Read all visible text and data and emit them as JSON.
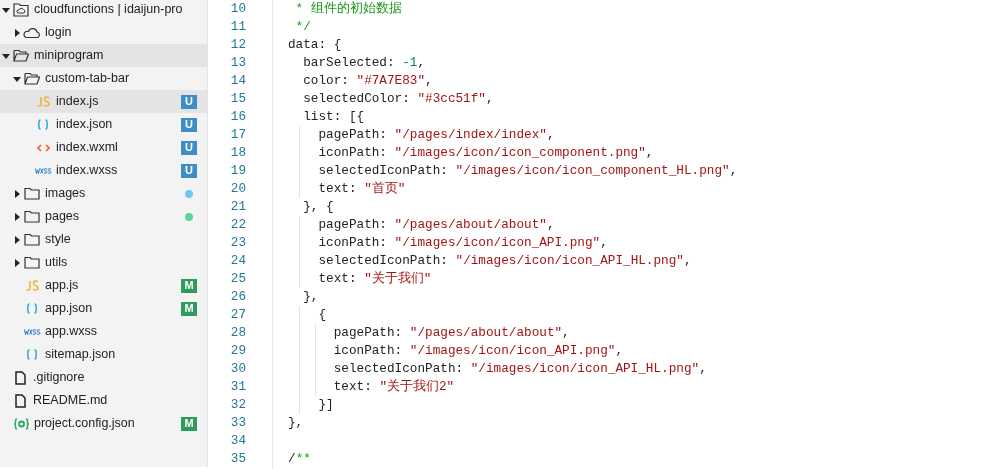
{
  "sidebar": {
    "items": [
      {
        "kind": "cloud-root",
        "label": "cloudfunctions | idaijun-pro",
        "expanded": true,
        "selected": false,
        "children": [
          {
            "kind": "cloud-folder",
            "label": "login",
            "expanded": false,
            "selected": false
          }
        ]
      },
      {
        "kind": "folder",
        "label": "miniprogram",
        "expanded": true,
        "selected": true,
        "children": [
          {
            "kind": "folder",
            "label": "custom-tab-bar",
            "expanded": true,
            "selected": false,
            "children": [
              {
                "kind": "js",
                "label": "index.js",
                "selected": true,
                "badge": {
                  "text": "U",
                  "color": "#3d8ec7"
                }
              },
              {
                "kind": "json",
                "label": "index.json",
                "selected": false,
                "badge": {
                  "text": "U",
                  "color": "#3d8ec7"
                }
              },
              {
                "kind": "wxml",
                "label": "index.wxml",
                "selected": false,
                "badge": {
                  "text": "U",
                  "color": "#3d8ec7"
                }
              },
              {
                "kind": "wxss",
                "label": "index.wxss",
                "selected": false,
                "badge": {
                  "text": "U",
                  "color": "#3d8ec7"
                }
              }
            ]
          },
          {
            "kind": "folder",
            "label": "images",
            "expanded": false,
            "selected": false,
            "color": "#6ec8f2"
          },
          {
            "kind": "folder",
            "label": "pages",
            "expanded": false,
            "selected": false,
            "color": "#5fd39c"
          },
          {
            "kind": "folder",
            "label": "style",
            "expanded": false,
            "selected": false
          },
          {
            "kind": "folder",
            "label": "utils",
            "expanded": false,
            "selected": false
          },
          {
            "kind": "js",
            "label": "app.js",
            "selected": false,
            "badge": {
              "text": "M",
              "color": "#2e9b5e"
            }
          },
          {
            "kind": "json",
            "label": "app.json",
            "selected": false,
            "badge": {
              "text": "M",
              "color": "#2e9b5e"
            }
          },
          {
            "kind": "wxss",
            "label": "app.wxss",
            "selected": false
          },
          {
            "kind": "json",
            "label": "sitemap.json",
            "selected": false
          }
        ]
      },
      {
        "kind": "file",
        "label": ".gitignore",
        "selected": false
      },
      {
        "kind": "file",
        "label": "README.md",
        "selected": false
      },
      {
        "kind": "config",
        "label": "project.config.json",
        "selected": false,
        "badge": {
          "text": "M",
          "color": "#2e9b5e"
        }
      }
    ]
  },
  "editor": {
    "lines": [
      {
        "number": "10",
        "tokens": [
          {
            "kind": "comment",
            "text": " * 组件的初始数据"
          }
        ]
      },
      {
        "number": "11",
        "tokens": [
          {
            "kind": "comment",
            "text": " */"
          }
        ]
      },
      {
        "number": "12",
        "tokens": [
          {
            "kind": "plain",
            "text": "data: {"
          }
        ]
      },
      {
        "number": "13",
        "tokens": [
          {
            "kind": "plain",
            "text": "  barSelected: "
          },
          {
            "kind": "number",
            "text": "-1"
          },
          {
            "kind": "plain",
            "text": ","
          }
        ]
      },
      {
        "number": "14",
        "tokens": [
          {
            "kind": "plain",
            "text": "  color: "
          },
          {
            "kind": "string",
            "text": "\"#7A7E83\""
          },
          {
            "kind": "plain",
            "text": ","
          }
        ]
      },
      {
        "number": "15",
        "tokens": [
          {
            "kind": "plain",
            "text": "  selectedColor: "
          },
          {
            "kind": "string",
            "text": "\"#3cc51f\""
          },
          {
            "kind": "plain",
            "text": ","
          }
        ]
      },
      {
        "number": "16",
        "tokens": [
          {
            "kind": "plain",
            "text": "  list: [{"
          }
        ]
      },
      {
        "number": "17",
        "tokens": [
          {
            "kind": "plain",
            "text": "    pagePath: "
          },
          {
            "kind": "string",
            "text": "\"/pages/index/index\""
          },
          {
            "kind": "plain",
            "text": ","
          }
        ]
      },
      {
        "number": "18",
        "tokens": [
          {
            "kind": "plain",
            "text": "    iconPath: "
          },
          {
            "kind": "string",
            "text": "\"/images/icon/icon_component.png\""
          },
          {
            "kind": "plain",
            "text": ","
          }
        ]
      },
      {
        "number": "19",
        "tokens": [
          {
            "kind": "plain",
            "text": "    selectedIconPath: "
          },
          {
            "kind": "string",
            "text": "\"/images/icon/icon_component_HL.png\""
          },
          {
            "kind": "plain",
            "text": ","
          }
        ]
      },
      {
        "number": "20",
        "tokens": [
          {
            "kind": "plain",
            "text": "    text: "
          },
          {
            "kind": "string",
            "text": "\"首页\""
          }
        ]
      },
      {
        "number": "21",
        "tokens": [
          {
            "kind": "plain",
            "text": "  }, {"
          }
        ]
      },
      {
        "number": "22",
        "tokens": [
          {
            "kind": "plain",
            "text": "    pagePath: "
          },
          {
            "kind": "string",
            "text": "\"/pages/about/about\""
          },
          {
            "kind": "plain",
            "text": ","
          }
        ]
      },
      {
        "number": "23",
        "tokens": [
          {
            "kind": "plain",
            "text": "    iconPath: "
          },
          {
            "kind": "string",
            "text": "\"/images/icon/icon_API.png\""
          },
          {
            "kind": "plain",
            "text": ","
          }
        ]
      },
      {
        "number": "24",
        "tokens": [
          {
            "kind": "plain",
            "text": "    selectedIconPath: "
          },
          {
            "kind": "string",
            "text": "\"/images/icon/icon_API_HL.png\""
          },
          {
            "kind": "plain",
            "text": ","
          }
        ]
      },
      {
        "number": "25",
        "tokens": [
          {
            "kind": "plain",
            "text": "    text: "
          },
          {
            "kind": "string",
            "text": "\"关于我们\""
          }
        ]
      },
      {
        "number": "26",
        "tokens": [
          {
            "kind": "plain",
            "text": "  },"
          }
        ]
      },
      {
        "number": "27",
        "tokens": [
          {
            "kind": "plain",
            "text": "    {"
          }
        ]
      },
      {
        "number": "28",
        "tokens": [
          {
            "kind": "plain",
            "text": "      pagePath: "
          },
          {
            "kind": "string",
            "text": "\"/pages/about/about\""
          },
          {
            "kind": "plain",
            "text": ","
          }
        ]
      },
      {
        "number": "29",
        "tokens": [
          {
            "kind": "plain",
            "text": "      iconPath: "
          },
          {
            "kind": "string",
            "text": "\"/images/icon/icon_API.png\""
          },
          {
            "kind": "plain",
            "text": ","
          }
        ]
      },
      {
        "number": "30",
        "tokens": [
          {
            "kind": "plain",
            "text": "      selectedIconPath: "
          },
          {
            "kind": "string",
            "text": "\"/images/icon/icon_API_HL.png\""
          },
          {
            "kind": "plain",
            "text": ","
          }
        ]
      },
      {
        "number": "31",
        "tokens": [
          {
            "kind": "plain",
            "text": "      text: "
          },
          {
            "kind": "string",
            "text": "\"关于我们2\""
          }
        ]
      },
      {
        "number": "32",
        "tokens": [
          {
            "kind": "plain",
            "text": "    }]"
          }
        ]
      },
      {
        "number": "33",
        "tokens": [
          {
            "kind": "plain",
            "text": "},"
          }
        ]
      },
      {
        "number": "34"
      },
      {
        "number": "35",
        "tokens": [
          {
            "kind": "plain",
            "text": "/"
          },
          {
            "kind": "comment",
            "text": "**"
          }
        ]
      }
    ]
  }
}
